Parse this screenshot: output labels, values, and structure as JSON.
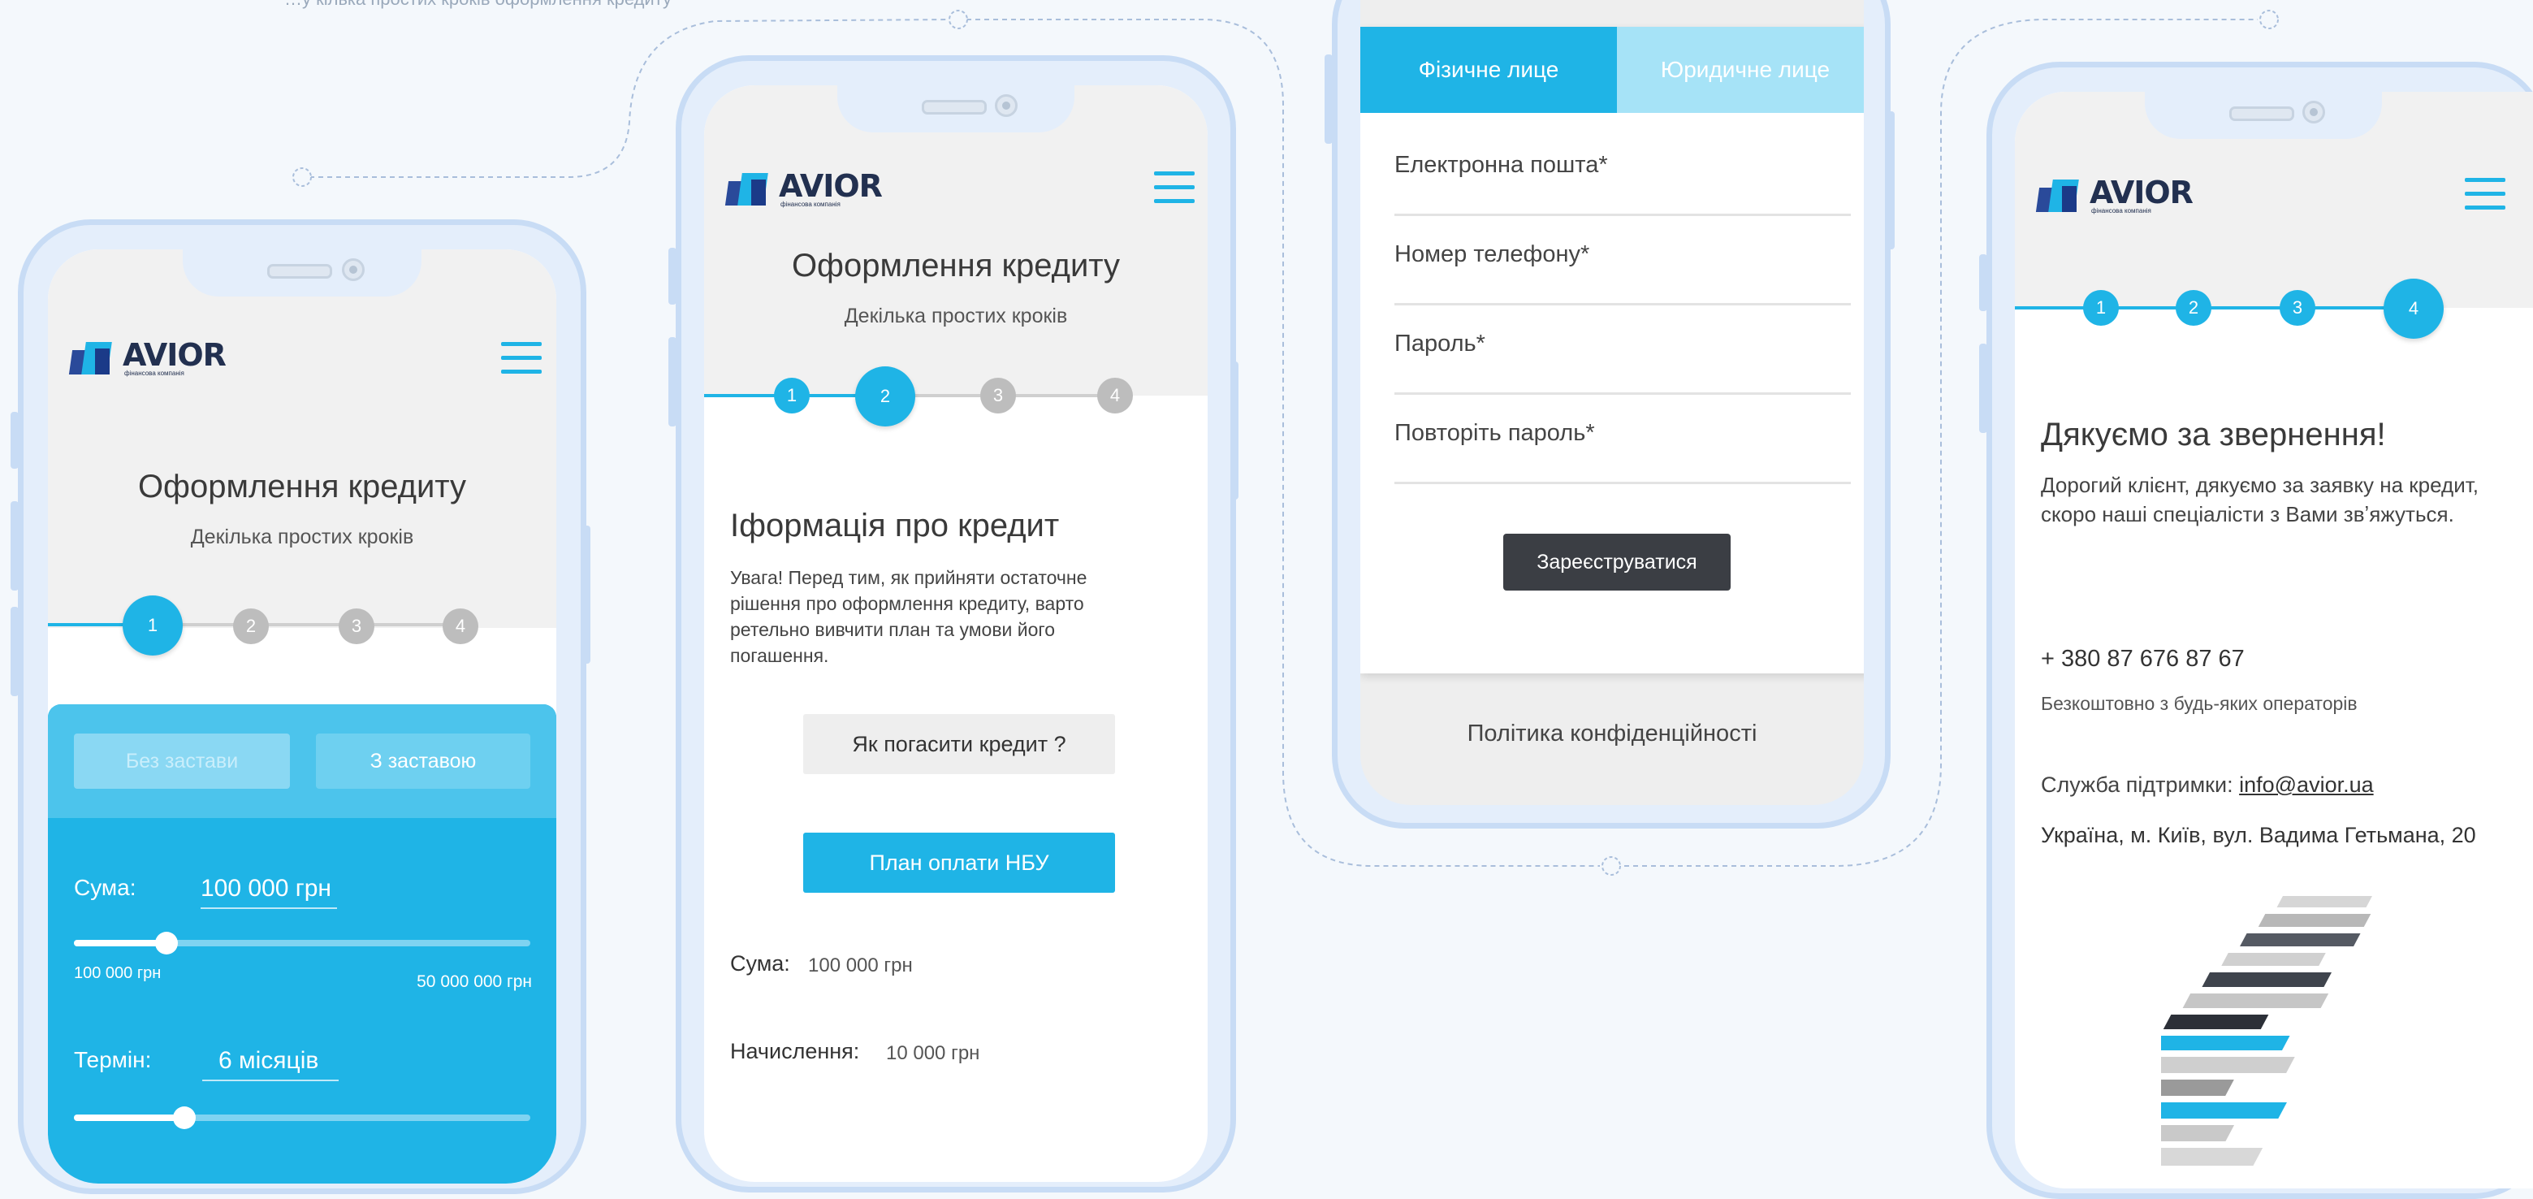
{
  "brand": {
    "name": "AVIOR",
    "tagline": "фінансова компанія"
  },
  "colors": {
    "accent": "#1fb4e6",
    "frame": "#c8dcf5",
    "dark_button": "#3b3e44"
  },
  "top_caption": "…у кілька простих кроків оформлення кредиту",
  "phone1": {
    "title": "Оформлення кредиту",
    "subtitle": "Декілька простих кроків",
    "steps": [
      "1",
      "2",
      "3",
      "4"
    ],
    "tabs": {
      "no_collateral": "Без застави",
      "with_collateral": "З заставою"
    },
    "sum": {
      "label": "Сума:",
      "value": "100 000 грн",
      "min": "100 000 грн",
      "max": "50 000 000 грн",
      "slider_fraction": 0.2
    },
    "term": {
      "label": "Термін:",
      "value": "6 місяців",
      "slider_fraction": 0.24
    }
  },
  "phone2": {
    "title": "Оформлення кредиту",
    "subtitle": "Декілька простих кроків",
    "steps": [
      "1",
      "2",
      "3",
      "4"
    ],
    "heading": "Іформація про кредит",
    "notice": "Увага! Перед тим, як прийняти остаточне рішення про оформлення кредиту, варто ретельно вивчити план та умови його погашення.",
    "how_to_repay": "Як погасити кредит ?",
    "nbu_plan": "План оплати НБУ",
    "sum_label": "Сума:",
    "sum_value": "100 000 грн",
    "accrual_label": "Начислення:",
    "accrual_value": "10 000 грн"
  },
  "phone3": {
    "tab_individual": "Фізичне лице",
    "tab_legal": "Юридичне лице",
    "email": "Електронна пошта*",
    "phone": "Номер телефону*",
    "password": "Пароль*",
    "repeat_password": "Повторіть пароль*",
    "register": "Зареєструватися",
    "privacy": "Політика конфіденційності"
  },
  "phone4": {
    "steps": [
      "1",
      "2",
      "3",
      "4"
    ],
    "heading": "Дякуємо за звернення!",
    "message": "Дорогий клієнт, дякуємо за заявку на кредит, скоро наші спеціалісти з Вами звʼяжуться.",
    "phone_number": "+ 380 87 676 87 67",
    "phone_note": "Безкоштовно з будь-яких операторів",
    "support_label": "Служба підтримки:",
    "support_email": "info@avior.ua",
    "address": "Україна, м. Київ, вул. Вадима Гетьмана, 20"
  }
}
